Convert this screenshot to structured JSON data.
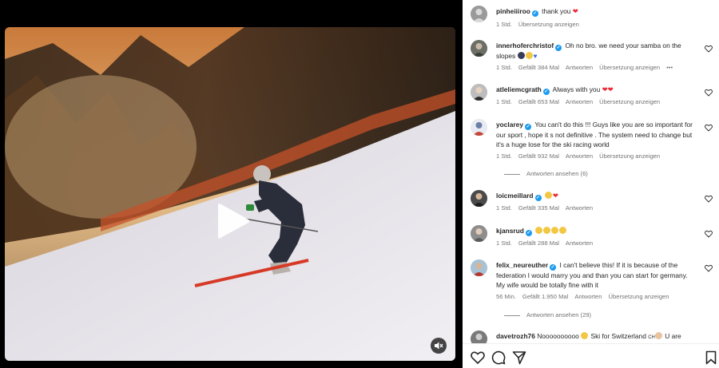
{
  "video": {
    "play_icon": "play-icon",
    "mute_icon": "speaker-muted-icon"
  },
  "comments": [
    {
      "username": "pinheiiiroo",
      "text": "thank you",
      "emoji": [
        "red-heart"
      ],
      "time": "1 Std.",
      "translate": "Übersetzung anzeigen"
    },
    {
      "username": "innerhoferchristof",
      "text": "Oh no bro. we need your samba on the slopes",
      "emoji": [
        "person",
        "crying-face",
        "blue-heart"
      ],
      "time": "1 Std.",
      "likes": "Gefällt 384 Mal",
      "reply": "Antworten",
      "translate": "Übersetzung anzeigen",
      "more": "•••"
    },
    {
      "username": "atleliemcgrath",
      "text": "Always with you",
      "emoji": [
        "red-heart",
        "red-heart"
      ],
      "time": "1 Std.",
      "likes": "Gefällt 653 Mal",
      "reply": "Antworten",
      "translate": "Übersetzung anzeigen"
    },
    {
      "username": "yoclarey",
      "text": "You can't do this !!! Guys like you are so important for our sport , hope it s not definitive . The system need to change but it's a huge lose for the ski racing world",
      "time": "1 Std.",
      "likes": "Gefällt 932 Mal",
      "reply": "Antworten",
      "translate": "Übersetzung anzeigen",
      "view_replies": "Antworten ansehen (6)"
    },
    {
      "username": "loicmeillard",
      "text": "",
      "emoji": [
        "sad-face",
        "red-heart"
      ],
      "time": "1 Std.",
      "likes": "Gefällt 335 Mal",
      "reply": "Antworten"
    },
    {
      "username": "kjansrud",
      "text": "",
      "emoji": [
        "sad-face",
        "sad-face",
        "sad-face",
        "sad-face"
      ],
      "time": "1 Std.",
      "likes": "Gefällt 288 Mal",
      "reply": "Antworten"
    },
    {
      "username": "felix_neureuther",
      "text": "I can't believe this! If it is because of the federation I would marry you and than you can start for germany. My wife would be totally fine with it",
      "time": "56 Min.",
      "likes": "Gefällt 1.950 Mal",
      "reply": "Antworten",
      "translate": "Übersetzung anzeigen",
      "view_replies": "Antworten ansehen (29)"
    },
    {
      "username": "davetrozh76",
      "text": "Noooooooooo",
      "text2": "Ski for Switzerland",
      "text3": "U are",
      "flag": "CH",
      "emoji": [
        "crying-face",
        "praying-hands"
      ]
    }
  ],
  "action_bar": {
    "like_icon": "heart-outline-icon",
    "comment_icon": "comment-icon",
    "share_icon": "share-icon",
    "save_icon": "bookmark-icon"
  },
  "colors": {
    "verified": "#1d9bf0",
    "heart_red": "#ed2839",
    "meta_grey": "#737373",
    "text": "#262626"
  }
}
